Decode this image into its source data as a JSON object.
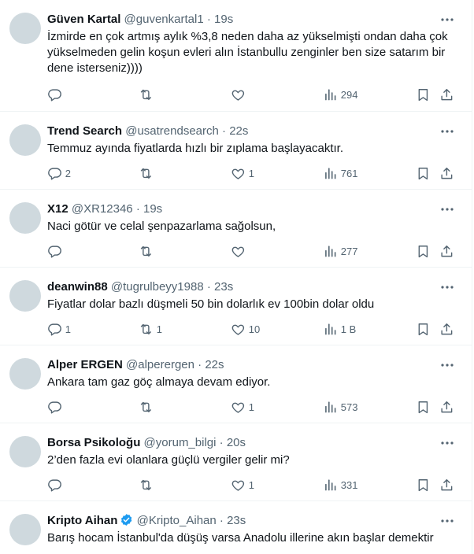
{
  "tweets": [
    {
      "name": "Güven Kartal",
      "handle": "@guvenkartal1",
      "time": "19s",
      "text": "İzmirde en çok artmış aylık %3,8 neden daha az yükselmişti ondan daha çok yükselmeden gelin koşun evleri alın İstanbullu zenginler ben size satarım bir dene isterseniz))))",
      "replies": "",
      "retweets": "",
      "likes": "",
      "views": "294",
      "verified": false
    },
    {
      "name": "Trend Search",
      "handle": "@usatrendsearch",
      "time": "22s",
      "text": "Temmuz ayında fiyatlarda hızlı bir zıplama başlayacaktır.",
      "replies": "2",
      "retweets": "",
      "likes": "1",
      "views": "761",
      "verified": false
    },
    {
      "name": "X12",
      "handle": "@XR12346",
      "time": "19s",
      "text": "Naci götür ve celal şenpazarlama sağolsun,",
      "replies": "",
      "retweets": "",
      "likes": "",
      "views": "277",
      "verified": false
    },
    {
      "name": "deanwin88",
      "handle": "@tugrulbeyy1988",
      "time": "23s",
      "text": "Fiyatlar dolar bazlı düşmeli 50 bin dolarlık ev 100bin dolar oldu",
      "replies": "1",
      "retweets": "1",
      "likes": "10",
      "views": "1 B",
      "verified": false
    },
    {
      "name": "Alper ERGEN",
      "handle": "@alperergen",
      "time": "22s",
      "text": "Ankara tam gaz göç almaya devam ediyor.",
      "replies": "",
      "retweets": "",
      "likes": "1",
      "views": "573",
      "verified": false
    },
    {
      "name": "Borsa Psikoloğu",
      "handle": "@yorum_bilgi",
      "time": "20s",
      "text": "2’den fazla evi olanlara güçlü vergiler gelir mi?",
      "replies": "",
      "retweets": "",
      "likes": "1",
      "views": "331",
      "verified": false
    },
    {
      "name": "Kripto Aihan",
      "handle": "@Kripto_Aihan",
      "time": "23s",
      "text": "Barış hocam İstanbul'da düşüş varsa Anadolu illerine akın başlar demektir",
      "replies": "",
      "retweets": "",
      "likes": "",
      "views": "",
      "verified": true
    }
  ],
  "separator": "·",
  "icons": {
    "reply": "reply-icon",
    "retweet": "retweet-icon",
    "like": "heart-icon",
    "views": "views-icon",
    "bookmark": "bookmark-icon",
    "share": "share-icon",
    "more": "more-icon",
    "verified": "verified-badge-icon"
  },
  "colors": {
    "text": "#0f1419",
    "secondary": "#536471",
    "divider": "#eff3f4",
    "avatar_placeholder": "#cfd9de",
    "verified": "#1d9bf0"
  }
}
